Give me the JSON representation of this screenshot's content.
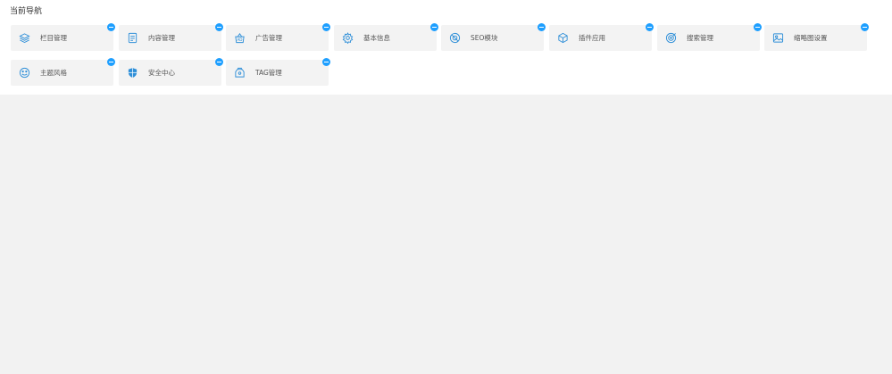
{
  "nav": {
    "title": "当前导航",
    "accent_color": "#1e9fff",
    "icon_color": "#2f8fd8",
    "items": [
      {
        "label": "栏目管理",
        "icon": "layers-icon"
      },
      {
        "label": "内容管理",
        "icon": "document-icon"
      },
      {
        "label": "广告管理",
        "icon": "ad-icon"
      },
      {
        "label": "基本信息",
        "icon": "gear-icon"
      },
      {
        "label": "SEO模块",
        "icon": "seo-icon"
      },
      {
        "label": "插件应用",
        "icon": "plugin-icon"
      },
      {
        "label": "搜索管理",
        "icon": "target-icon"
      },
      {
        "label": "缩略图设置",
        "icon": "image-icon"
      },
      {
        "label": "主题风格",
        "icon": "theme-icon"
      },
      {
        "label": "安全中心",
        "icon": "shield-icon"
      },
      {
        "label": "TAG管理",
        "icon": "tag-icon"
      }
    ]
  }
}
